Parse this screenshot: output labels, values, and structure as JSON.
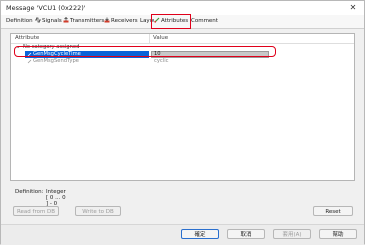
{
  "window": {
    "title": "Message 'VCU1 (0x222)'",
    "close_glyph": "✕"
  },
  "tabs": [
    {
      "label": "Definition",
      "icon": ""
    },
    {
      "label": "Signals",
      "icon": "signals-icon"
    },
    {
      "label": "Transmitters",
      "icon": "transmitter-icon"
    },
    {
      "label": "Receivers",
      "icon": "receiver-icon"
    },
    {
      "label": "Layout",
      "icon": ""
    },
    {
      "label": "Attributes",
      "icon": "attributes-icon",
      "active": true
    },
    {
      "label": "Comment",
      "icon": ""
    }
  ],
  "table": {
    "col_attribute": "Attribute",
    "col_value": "Value",
    "group": {
      "caret": "⌄",
      "label": "No category assigned"
    },
    "rows": [
      {
        "attribute": "GenMsgCycleTime",
        "value": "10",
        "selected": true
      },
      {
        "attribute": "GenMsgSendType",
        "value": "cyclic",
        "selected": false
      }
    ]
  },
  "definition": {
    "label": "Definition:",
    "value": "Integer [ 0 ... 0 ] - 0"
  },
  "buttons": {
    "read_from_db": "Read from DB",
    "write_to_db": "Write to DB",
    "reset": "Reset"
  },
  "footer": {
    "ok": "確定",
    "cancel": "取消",
    "apply": "套用(A)",
    "help": "幫助"
  },
  "colors": {
    "selection": "#0a64d8",
    "highlight_box": "#e0001a"
  }
}
